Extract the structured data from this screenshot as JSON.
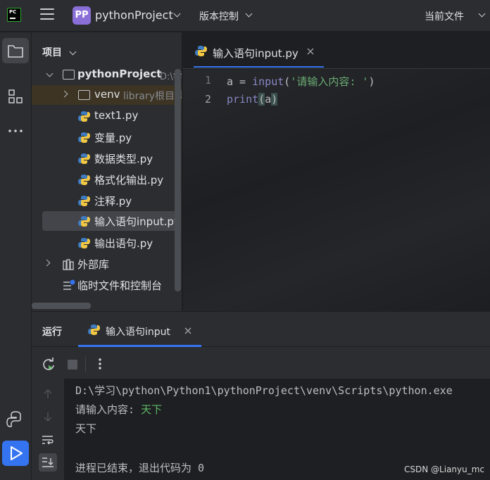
{
  "titlebar": {
    "project_badge": "PP",
    "project_name": "pythonProject",
    "vcs_label": "版本控制",
    "current_file_label": "当前文件"
  },
  "project_panel": {
    "header": "项目",
    "root_name": "pythonProject",
    "root_path": "D:\\学",
    "venv_name": "venv",
    "venv_hint": "library根目录",
    "files": [
      "text1.py",
      "变量.py",
      "数据类型.py",
      "格式化输出.py",
      "注释.py",
      "输入语句input.py",
      "输出语句.py"
    ],
    "selected_file": "输入语句input.py",
    "external_libs": "外部库",
    "scratches": "临时文件和控制台"
  },
  "editor": {
    "tab_label": "输入语句input.py",
    "line_numbers": [
      "1",
      "2"
    ],
    "line1": {
      "var": "a",
      "op": " = ",
      "func": "input",
      "open": "(",
      "str": "'请输入内容: '",
      "close": ")"
    },
    "line2": {
      "func": "print",
      "open": "(",
      "arg": "a",
      "close": ")"
    }
  },
  "run_panel": {
    "title": "运行",
    "tab_label": "输入语句input",
    "console": {
      "command": "D:\\学习\\python\\Python1\\pythonProject\\venv\\Scripts\\python.exe",
      "prompt": "请输入内容: ",
      "user_input": "天下",
      "output": "天下",
      "exit_message": "进程已结束，退出代码为 0"
    }
  },
  "watermark": "CSDN @Lianyu_mc",
  "colors": {
    "accent": "#3574f0",
    "run_active": "#3574f0",
    "keyword_func": "#56a8f5",
    "builtin": "#8888c6",
    "string": "#6aab73",
    "input_echo": "#5fb865"
  }
}
